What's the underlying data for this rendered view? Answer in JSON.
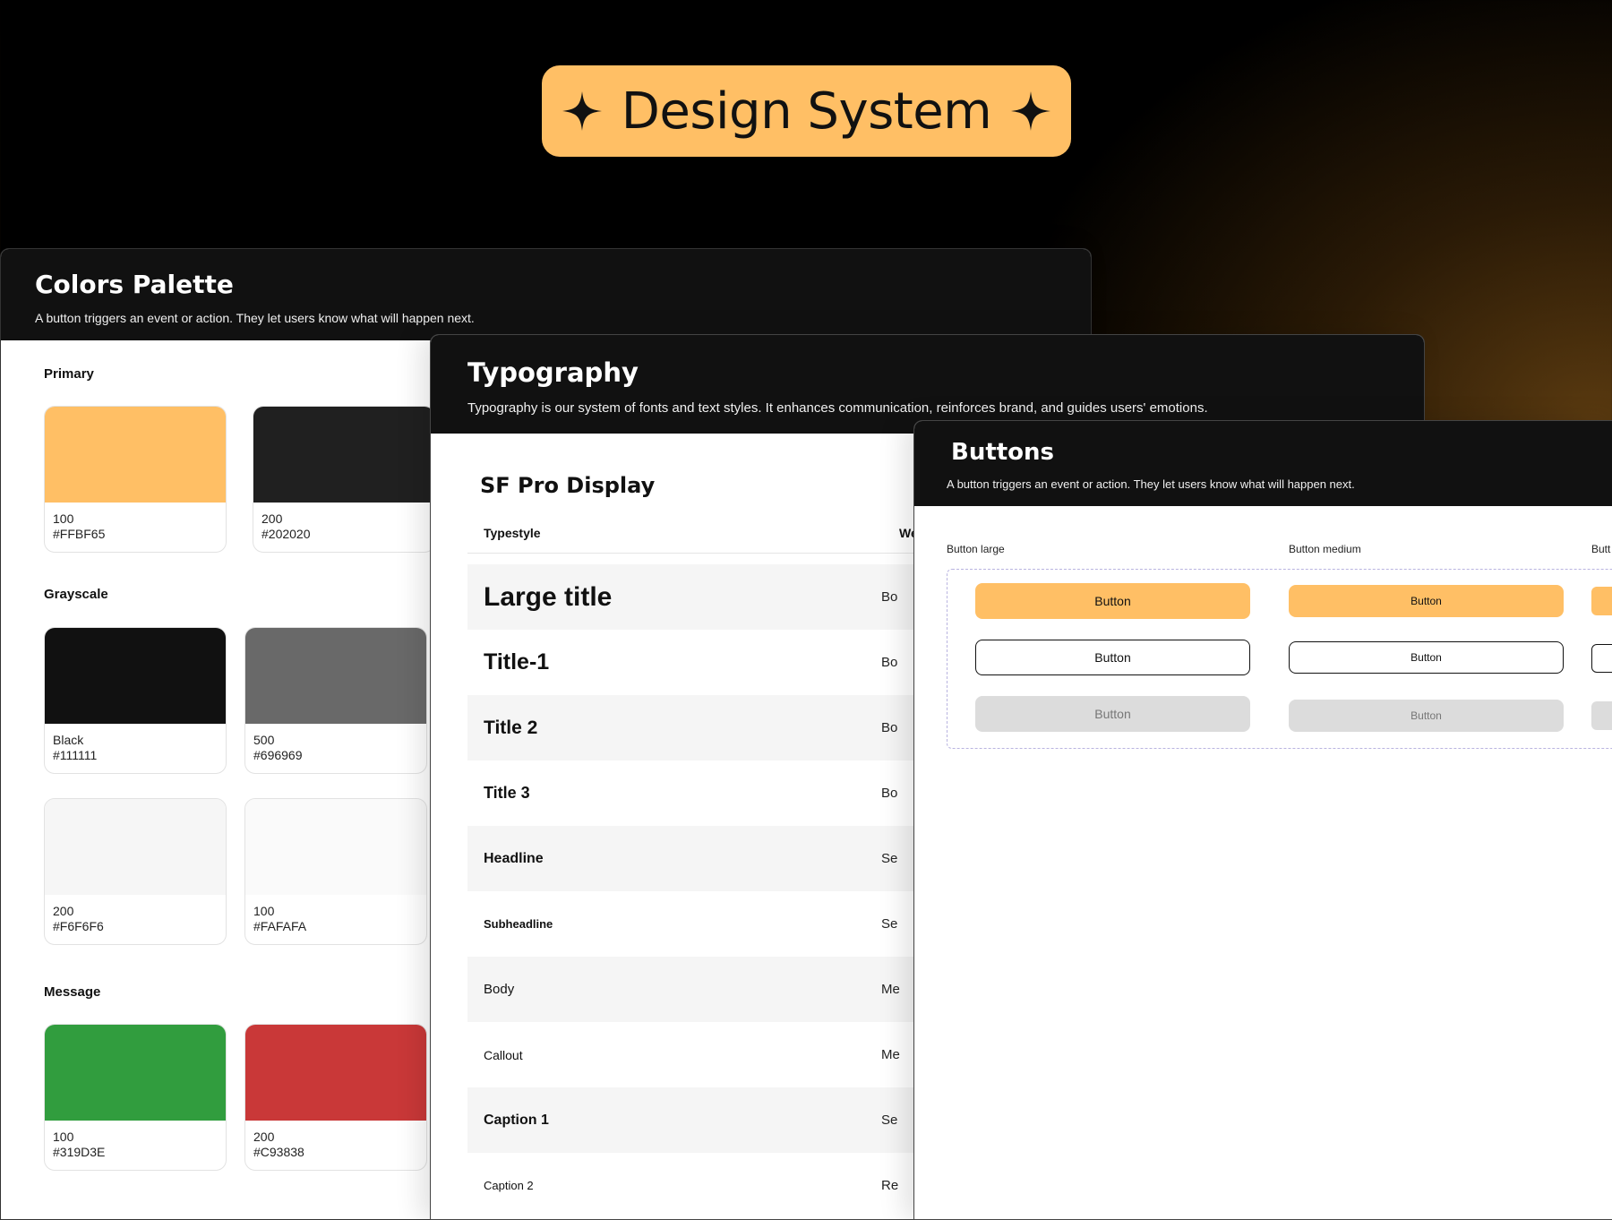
{
  "hero": {
    "title": "Design System"
  },
  "colors": {
    "title": "Colors Palette",
    "description": "A button triggers an event or action. They let users know what will happen next.",
    "sections": {
      "primary": "Primary",
      "grayscale": "Grayscale",
      "message": "Message"
    },
    "swatches": {
      "p100": {
        "shade": "100",
        "hex": "#FFBF65",
        "color": "#FFBF65"
      },
      "p200": {
        "shade": "200",
        "hex": "#202020",
        "color": "#202020"
      },
      "gblack": {
        "shade": "Black",
        "hex": "#111111",
        "color": "#111111"
      },
      "g500": {
        "shade": "500",
        "hex": "#696969",
        "color": "#696969"
      },
      "g200": {
        "shade": "200",
        "hex": "#F6F6F6",
        "color": "#F6F6F6"
      },
      "g100": {
        "shade": "100",
        "hex": "#FAFAFA",
        "color": "#FAFAFA"
      },
      "m100": {
        "shade": "100",
        "hex": "#319D3E",
        "color": "#319D3E"
      },
      "m200": {
        "shade": "200",
        "hex": "#C93838",
        "color": "#C93838"
      }
    }
  },
  "typography": {
    "title": "Typography",
    "description": "Typography is our system of fonts and text styles. It enhances communication, reinforces brand, and guides users' emotions.",
    "font_name": "SF Pro Display",
    "columns": {
      "typestyle": "Typestyle",
      "weight": "We"
    },
    "rows": [
      {
        "name": "Large title",
        "weight": "Bo"
      },
      {
        "name": "Title-1",
        "weight": "Bo"
      },
      {
        "name": "Title 2",
        "weight": "Bo"
      },
      {
        "name": "Title 3",
        "weight": "Bo"
      },
      {
        "name": "Headline",
        "weight": "Se"
      },
      {
        "name": "Subheadline",
        "weight": "Se"
      },
      {
        "name": "Body",
        "weight": "Me"
      },
      {
        "name": "Callout",
        "weight": "Me"
      },
      {
        "name": "Caption 1",
        "weight": "Se"
      },
      {
        "name": "Caption 2",
        "weight": "Re"
      }
    ]
  },
  "buttons": {
    "title": "Buttons",
    "description": "A button triggers an event or action. They let users know what will happen next.",
    "sizes": {
      "large": "Button large",
      "medium": "Button medium",
      "small": "Butt"
    },
    "label": "Button"
  },
  "theme": {
    "accent": "#FFBF65",
    "dark": "#111111"
  }
}
